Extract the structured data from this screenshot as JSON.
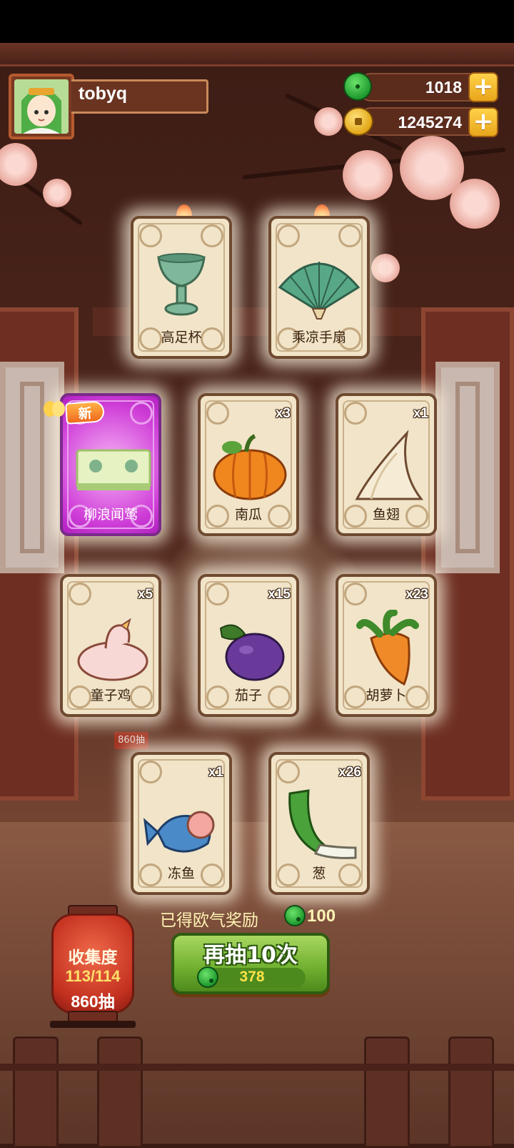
{
  "header": {
    "username": "tobyq",
    "avatar_icon": "girl-avatar",
    "jade": {
      "icon": "jade-icon",
      "value": "1018"
    },
    "coins": {
      "icon": "coin-icon",
      "value": "1245274"
    }
  },
  "cards": [
    {
      "label": "高足杯",
      "count": "",
      "hot": true,
      "icon": "cup-icon"
    },
    {
      "label": "乘凉手扇",
      "count": "",
      "hot": true,
      "icon": "fan-icon"
    },
    {
      "label": "柳浪闻莺",
      "count": "",
      "new": true,
      "new_badge": "新",
      "icon": "plaque-icon"
    },
    {
      "label": "南瓜",
      "count": "x3",
      "icon": "pumpkin-icon"
    },
    {
      "label": "鱼翅",
      "count": "x1",
      "icon": "shark-fin-icon"
    },
    {
      "label": "童子鸡",
      "count": "x5",
      "icon": "chicken-icon"
    },
    {
      "label": "茄子",
      "count": "x15",
      "icon": "eggplant-icon"
    },
    {
      "label": "胡萝卜",
      "count": "x23",
      "icon": "carrot-icon"
    },
    {
      "label": "冻鱼",
      "count": "x1",
      "icon": "fish-icon"
    },
    {
      "label": "葱",
      "count": "x26",
      "icon": "scallion-icon"
    }
  ],
  "bg_tag": "860抽",
  "reward": {
    "text": "已得欧气奖励",
    "value": "100"
  },
  "collection": {
    "title": "收集度",
    "progress": "113/114",
    "draws": "860抽"
  },
  "draw_button": {
    "label": "再抽10次",
    "cost": "378"
  },
  "colors": {
    "accent_green": "#6eae2e",
    "gold": "#e8a51a",
    "card_bg": "#f1e4c8",
    "new_card": "#d040d8"
  }
}
